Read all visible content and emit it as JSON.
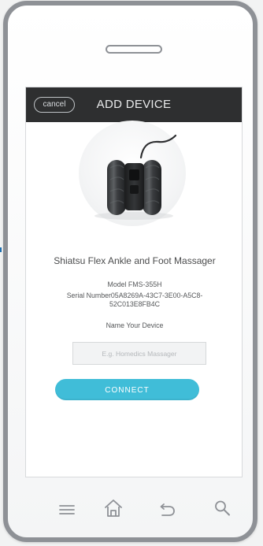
{
  "header": {
    "cancel_label": "cancel",
    "title": "ADD DEVICE"
  },
  "product": {
    "name": "Shiatsu Flex Ankle and Foot Massager",
    "model": "Model FMS-355H",
    "serial_number": "Serial Number05A8269A-43C7-3E00-A5C8-",
    "serial_continuation": "52C013E8FB4C",
    "image_icon": "foot-massager-image"
  },
  "form": {
    "name_label": "Name Your Device",
    "input_value": "",
    "input_placeholder": "E.g. Homedics Massager",
    "connect_label": "CONNECT"
  },
  "phone_nav": {
    "icons": [
      "menu-icon",
      "home-icon",
      "back-icon",
      "search-icon"
    ]
  },
  "colors": {
    "phone_frame": "#8e9196",
    "header_bg": "#2e2f30",
    "accent": "#40bdd8",
    "text": "#4b4c4d"
  }
}
